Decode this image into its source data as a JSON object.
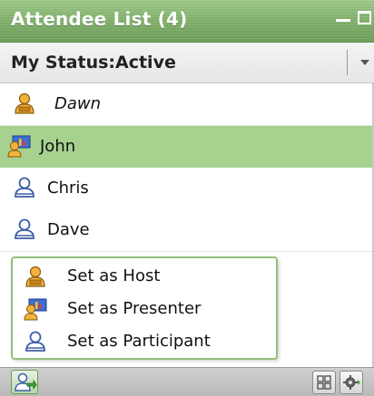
{
  "window": {
    "title": "Attendee List (4)"
  },
  "status": {
    "label": "My Status:Active"
  },
  "attendees": [
    {
      "name": "Dawn",
      "role_icon": "host-icon"
    },
    {
      "name": "John",
      "role_icon": "presenter-icon"
    },
    {
      "name": "Chris",
      "role_icon": "participant-icon"
    },
    {
      "name": "Dave",
      "role_icon": "participant-icon"
    }
  ],
  "context_menu": {
    "items": [
      {
        "label": "Set as Host",
        "icon": "host-icon"
      },
      {
        "label": "Set as Presenter",
        "icon": "presenter-icon"
      },
      {
        "label": "Set as Participant",
        "icon": "participant-icon"
      }
    ]
  },
  "toolbar": {
    "left_icon": "assign-role-icon",
    "right_icons": [
      "grid-view-icon",
      "settings-gear-icon"
    ]
  },
  "colors": {
    "title_bar": "#80b06b",
    "selected_row": "#a6d18f",
    "menu_border": "#8fbf7a",
    "host_icon": "#d89a2a",
    "participant_icon": "#5e7fbf"
  }
}
